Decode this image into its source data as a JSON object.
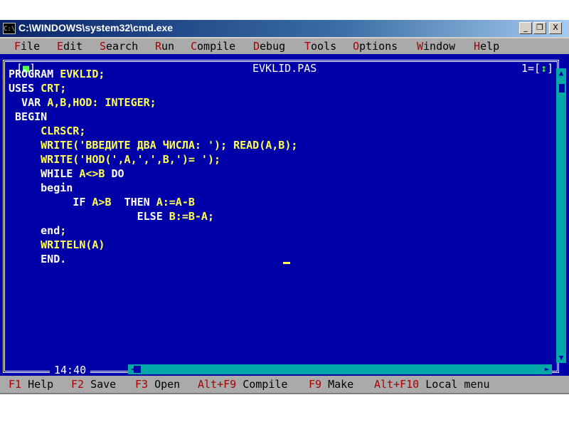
{
  "window": {
    "title": "C:\\WINDOWS\\system32\\cmd.exe",
    "icon_label": "C:\\",
    "minimize": "_",
    "restore": "❐",
    "close": "X"
  },
  "menu": {
    "items": [
      {
        "hotkey": "F",
        "rest": "ile"
      },
      {
        "hotkey": "E",
        "rest": "dit"
      },
      {
        "hotkey": "S",
        "rest": "earch"
      },
      {
        "hotkey": "R",
        "rest": "un"
      },
      {
        "hotkey": "C",
        "rest": "ompile"
      },
      {
        "hotkey": "D",
        "rest": "ebug"
      },
      {
        "hotkey": "T",
        "rest": "ools"
      },
      {
        "hotkey": "O",
        "rest": "ptions"
      },
      {
        "hotkey": "W",
        "rest": "indow"
      },
      {
        "hotkey": "H",
        "rest": "elp"
      }
    ]
  },
  "editor": {
    "filename": "EVKLID.PAS",
    "close_box": {
      "left": "[",
      "mark": "■",
      "right": "]"
    },
    "window_number": {
      "left": "1=[",
      "mark": "↕",
      "right": "]"
    },
    "cursor_position": "14:40",
    "code_lines": [
      {
        "kw": "PROGRAM ",
        "rest": "EVKLID;"
      },
      {
        "kw": "USES ",
        "rest": "CRT;"
      },
      {
        "kw": "  VAR ",
        "rest": "A,B,HOD: INTEGER;"
      },
      {
        "kw": " BEGIN",
        "rest": ""
      },
      {
        "kw": "     ",
        "rest": "CLRSCR;"
      },
      {
        "kw": "     ",
        "rest": "WRITE('ВВЕДИТЕ ДВА ЧИСЛА: '); READ(A,B);"
      },
      {
        "kw": "     ",
        "rest": "WRITE('HOD(',A,',',B,')= ');"
      },
      {
        "kw": "     WHILE ",
        "rest": "A<>B ",
        "kw2": "DO"
      },
      {
        "kw": "     begin",
        "rest": ""
      },
      {
        "kw": "          IF ",
        "rest": "A>B  ",
        "kw2": "THEN ",
        "rest2": "A:=A-B"
      },
      {
        "kw": "                    ELSE ",
        "rest": "B:=B-A;"
      },
      {
        "kw": "     end",
        "rest": ";"
      },
      {
        "kw": "     ",
        "rest": "WRITELN(A)"
      },
      {
        "kw": "     END.",
        "rest": ""
      }
    ]
  },
  "statusbar": {
    "items": [
      {
        "key": "F1",
        "label": " Help"
      },
      {
        "key": "F2",
        "label": " Save"
      },
      {
        "key": "F3",
        "label": " Open"
      },
      {
        "key": "Alt+F9",
        "label": " Compile"
      },
      {
        "key": "F9",
        "label": " Make"
      },
      {
        "key": "Alt+F10",
        "label": " Local menu"
      }
    ]
  },
  "colors": {
    "editor_bg": "#0000a8",
    "keyword": "#ffffff",
    "identifier": "#ffff55",
    "menu_bg": "#aaaaaa",
    "hotkey": "#aa0000"
  }
}
